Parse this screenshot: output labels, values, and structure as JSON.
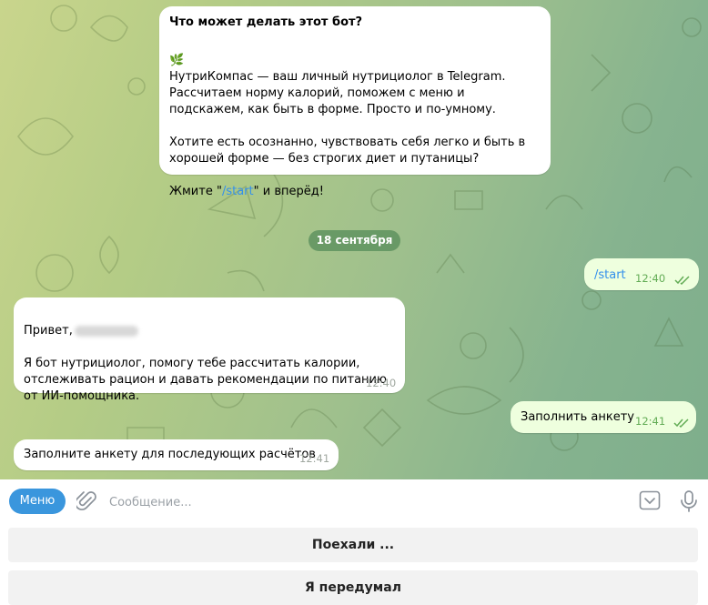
{
  "bot_intro": {
    "title": "Что может делать этот бот?",
    "paragraph1": "НутриКомпас — ваш личный нутрициолог в Telegram. Рассчитаем норму калорий, поможем с меню и подскажем, как быть в форме. Просто и по-умному.",
    "paragraph2": "Хотите есть осознанно, чувствовать себя легко и быть в хорошей форме — без строгих диет и путаницы?",
    "cta_prefix": "Жмите \"",
    "cta_command": "/start",
    "cta_suffix": "\" и вперёд!"
  },
  "date_separator": "18 сентября",
  "messages": [
    {
      "direction": "out",
      "text": "/start",
      "time": "12:40",
      "status": "read"
    },
    {
      "direction": "in",
      "greeting": "Привет,",
      "text": "Я бот нутрициолог, помогу тебе рассчитать калории, отслеживать рацион и давать рекомендации по питанию от ИИ-помощника.",
      "time": "12:40"
    },
    {
      "direction": "out",
      "text": "Заполнить анкету",
      "time": "12:41",
      "status": "read"
    },
    {
      "direction": "in",
      "text": "Заполните анкету для последующих расчётов",
      "time": "12:41"
    }
  ],
  "composer": {
    "menu_label": "Меню",
    "placeholder": "Сообщение..."
  },
  "keyboard": [
    {
      "label": "Поехали ..."
    },
    {
      "label": "Я передумал"
    }
  ],
  "colors": {
    "accent": "#3a96dd",
    "link": "#3390ec",
    "outgoing_bubble": "#eeffde",
    "read_check": "#62ac55"
  }
}
